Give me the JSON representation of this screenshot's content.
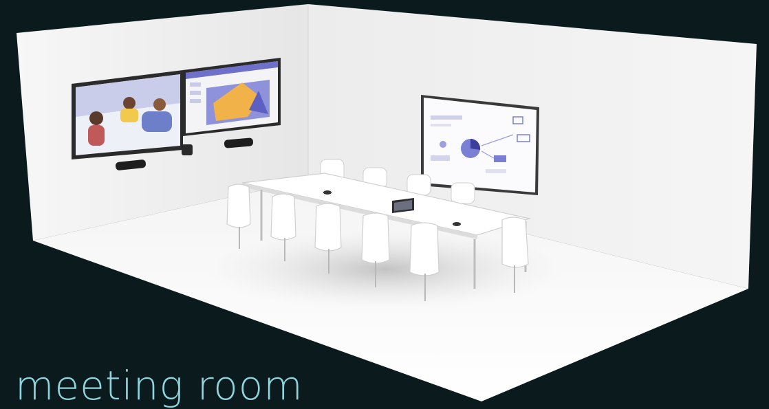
{
  "caption": "meeting room",
  "colors": {
    "background": "#0b1a1d",
    "caption": "#8fd6df",
    "wall": "#f2f2f2",
    "floor": "#f7f7f7",
    "screen_frame": "#2a2a2a",
    "screen_accent": "#f2b24a",
    "screen_purple": "#7c7fd6"
  },
  "icons": {
    "left_display": "video-call-display-icon",
    "right_display": "presentation-display-icon",
    "whiteboard": "diagram-whiteboard-icon",
    "camera": "camera-icon",
    "speaker": "speaker-bar-icon",
    "laptop": "laptop-icon"
  }
}
